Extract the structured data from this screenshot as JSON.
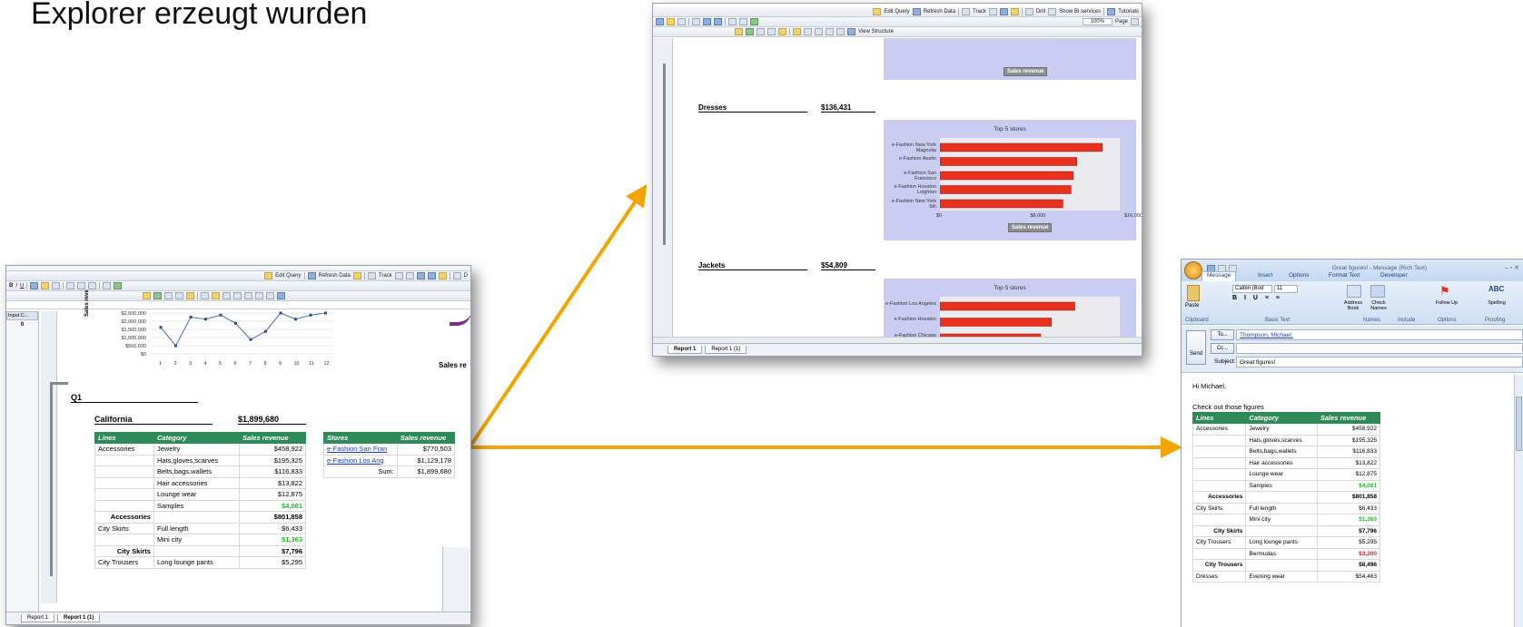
{
  "slide": {
    "title": "Explorer erzeugt wurden"
  },
  "colors": {
    "arrow": "#f0a500",
    "header_green": "#2e8b57",
    "bar_red": "#e8321e",
    "chart_bg": "#c9cdf2"
  },
  "report_window": {
    "toolbar": {
      "edit_query": "Edit Query",
      "refresh_data": "Refresh Data",
      "track": "Track",
      "drill": "D"
    },
    "input_controls": {
      "label": "Input C...",
      "value": "0"
    },
    "line_chart": {
      "y_ticks": [
        "$2,500,000",
        "$2,000,000",
        "$1,500,000",
        "$1,000,000",
        "$500,000",
        "$0"
      ],
      "x_ticks": [
        "1",
        "2",
        "3",
        "4",
        "5",
        "6",
        "7",
        "8",
        "9",
        "10",
        "11",
        "12"
      ],
      "ylabel": "Sales reve",
      "side_title": "Sales re"
    },
    "quarter": "Q1",
    "state": {
      "name": "California",
      "total": "$1,899,680"
    },
    "table": {
      "headers": [
        "Lines",
        "Category",
        "Sales revenue"
      ],
      "rows": [
        [
          "Accessories",
          "Jewelry",
          "$458,922",
          ""
        ],
        [
          "",
          "Hats,gloves,scarves",
          "$195,325",
          ""
        ],
        [
          "",
          "Belts,bags,wallets",
          "$116,833",
          ""
        ],
        [
          "",
          "Hair accessories",
          "$13,822",
          ""
        ],
        [
          "",
          "Lounge wear",
          "$12,875",
          ""
        ],
        [
          "",
          "Samples",
          "$4,081",
          "green"
        ],
        [
          "Accessories",
          "",
          "$801,858",
          "sub"
        ],
        [
          "City Skirts",
          "Full length",
          "$6,433",
          ""
        ],
        [
          "",
          "Mini city",
          "$1,363",
          "green"
        ],
        [
          "City Skirts",
          "",
          "$7,796",
          "sub"
        ],
        [
          "City Trousers",
          "Long lounge pants",
          "$5,295",
          ""
        ]
      ]
    },
    "stores_table": {
      "headers": [
        "Stores",
        "Sales revenue"
      ],
      "rows": [
        [
          "e-Fashion San Fran",
          "$770,503"
        ],
        [
          "e-Fashion Los Ang",
          "$1,129,178"
        ],
        [
          "Sum:",
          "$1,899,680"
        ]
      ]
    },
    "tabs": [
      "Report 1",
      "Report 1 (1)"
    ]
  },
  "chart_window": {
    "toolbar": {
      "edit_query": "Edit Query",
      "refresh_data": "Refresh Data",
      "track": "Track",
      "drill": "Drill",
      "show_bi": "Show BI services",
      "tutorials": "Tutorials",
      "zoom": "100%",
      "page": "Page",
      "view_structure": "View Structure"
    },
    "top_axis_badge": "Sales revenue",
    "sections": [
      {
        "name": "Dresses",
        "value": "$136,431"
      },
      {
        "name": "Jackets",
        "value": "$54,809"
      }
    ],
    "chart_data": [
      {
        "type": "bar",
        "title": "Top 5 stores",
        "categories": [
          "e-Fashion New York Magnolia",
          "e-Fashion Austin",
          "e-Fashion San Francisco",
          "e-Fashion Houston Leighton",
          "e-Fashion New York 5th"
        ],
        "values": [
          14000,
          11800,
          11500,
          11300,
          10600
        ],
        "xlabel": "Sales revenue",
        "x_ticks": [
          "$0",
          "$8,000",
          "$16,000"
        ],
        "xlim": [
          0,
          15500
        ]
      },
      {
        "type": "bar",
        "title": "Top 5 stores",
        "categories": [
          "e-Fashion Los Angeles",
          "e-Fashion Houston",
          "e-Fashion Chicago"
        ],
        "values": [
          7500,
          6200,
          5600
        ],
        "xlabel": "",
        "x_ticks": [],
        "xlim": [
          0,
          10000
        ]
      }
    ],
    "tabs": [
      "Report 1",
      "Report 1 (1)"
    ]
  },
  "outlook_window": {
    "title": "Great figures! - Message (Rich Text)",
    "ribbon_tabs": [
      "Message",
      "Insert",
      "Options",
      "Format Text",
      "Developer"
    ],
    "ribbon_groups": [
      "Clipboard",
      "Basic Text",
      "Names",
      "Include",
      "Options",
      "Proofing"
    ],
    "ribbon_buttons": {
      "paste": "Paste",
      "address_book": "Address Book",
      "check_names": "Check Names",
      "follow_up": "Follow Up",
      "spelling": "Spelling",
      "font": "Calibri (Bod",
      "size": "11"
    },
    "send": "Send",
    "to_label": "To...",
    "to_value": "Thompson, Michael;",
    "cc_label": "Cc...",
    "subject_label": "Subject:",
    "subject_value": "Great figures!",
    "greeting": "Hi Michael,",
    "intro": "Check out those figures",
    "table": {
      "headers": [
        "Lines",
        "Category",
        "Sales revenue"
      ],
      "rows": [
        [
          "Accessories",
          "Jewelry",
          "$458,922",
          ""
        ],
        [
          "",
          "Hats,gloves,scarves",
          "$195,325",
          ""
        ],
        [
          "",
          "Belts,bags,wallets",
          "$116,833",
          ""
        ],
        [
          "",
          "Hair accessories",
          "$13,822",
          ""
        ],
        [
          "",
          "Lounge wear",
          "$12,875",
          ""
        ],
        [
          "",
          "Samples",
          "$4,081",
          "green"
        ],
        [
          "Accessories",
          "",
          "$801,858",
          "sub"
        ],
        [
          "City Skirts",
          "Full length",
          "$6,433",
          ""
        ],
        [
          "",
          "Mini city",
          "$1,363",
          "green"
        ],
        [
          "City Skirts",
          "",
          "$7,796",
          "sub"
        ],
        [
          "City Trousers",
          "Long lounge pants",
          "$5,295",
          ""
        ],
        [
          "",
          "Bermudas",
          "$3,200",
          "red"
        ],
        [
          "City Trousers",
          "",
          "$8,496",
          "sub"
        ],
        [
          "Dresses",
          "Evening wear",
          "$54,463",
          ""
        ]
      ]
    }
  }
}
